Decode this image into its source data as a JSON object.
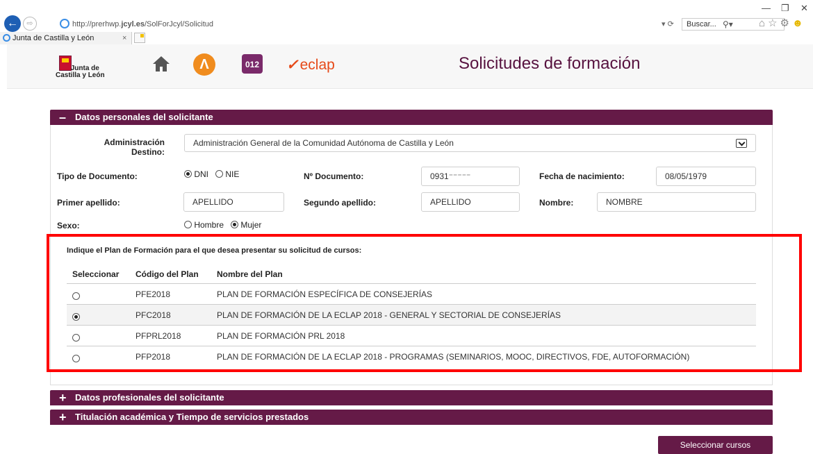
{
  "browser": {
    "url_prefix": "http://prerhwp.",
    "url_domain": "jcyl.es",
    "url_path": "/SolForJcyl/Solicitud",
    "addr_controls": "▾ ⟳",
    "search_placeholder": "Buscar...",
    "tab_title": "Junta de Castilla y León",
    "tab_close": "×",
    "win_min": "—",
    "win_max": "❐",
    "win_close": "✕",
    "nav_back": "←",
    "nav_forward": "⇨",
    "search_icon": "⚲▾"
  },
  "header": {
    "logo_line1": "Junta de",
    "logo_line2": "Castilla y León",
    "ai_icon": "Λ",
    "a012_icon": "012",
    "eclap_mark": "✓",
    "eclap_text": "eclap",
    "title": "Solicitudes de formación"
  },
  "personal": {
    "panel_title": "Datos personales del solicitante",
    "toggle": "–",
    "admin_label_1": "Administración",
    "admin_label_2": "Destino:",
    "admin_value": "Administración General de la Comunidad Autónoma de Castilla y León",
    "tipo_doc_label": "Tipo de Documento:",
    "tipo_doc_options": [
      "DNI",
      "NIE"
    ],
    "tipo_doc_selected": "DNI",
    "num_doc_label": "Nº Documento:",
    "num_doc_value": "0931⁻⁻⁻⁻⁻",
    "fecha_label": "Fecha de nacimiento:",
    "fecha_value": "08/05/1979",
    "apellido1_label": "Primer apellido:",
    "apellido1_value": "APELLIDO",
    "apellido2_label": "Segundo apellido:",
    "apellido2_value": "APELLIDO",
    "nombre_label": "Nombre:",
    "nombre_value": "NOMBRE",
    "sexo_label": "Sexo:",
    "sexo_options": [
      "Hombre",
      "Mujer"
    ],
    "sexo_selected": "Mujer"
  },
  "plan": {
    "question": "Indique el Plan de Formación para el que desea presentar su solicitud de cursos:",
    "headers": [
      "Seleccionar",
      "Código del Plan",
      "Nombre del Plan"
    ],
    "rows": [
      {
        "code": "PFE2018",
        "name": "PLAN DE FORMACIÓN ESPECÍFICA DE CONSEJERÍAS",
        "selected": false
      },
      {
        "code": "PFC2018",
        "name": "PLAN DE FORMACIÓN DE LA ECLAP 2018 - GENERAL Y SECTORIAL DE CONSEJERÍAS",
        "selected": true
      },
      {
        "code": "PFPRL2018",
        "name": "PLAN DE FORMACIÓN PRL 2018",
        "selected": false
      },
      {
        "code": "PFP2018",
        "name": "PLAN DE FORMACIÓN DE LA ECLAP 2018 - PROGRAMAS (SEMINARIOS, MOOC, DIRECTIVOS, FDE, AUTOFORMACIÓN)",
        "selected": false
      }
    ]
  },
  "panels": {
    "profesionales": "Datos profesionales del solicitante",
    "titulacion": "Titulación académica y Tiempo de servicios prestados",
    "expand": "+"
  },
  "actions": {
    "select_courses": "Seleccionar cursos"
  },
  "colors": {
    "brand": "#651a47",
    "title": "#57123f",
    "highlight": "#ff0000"
  }
}
